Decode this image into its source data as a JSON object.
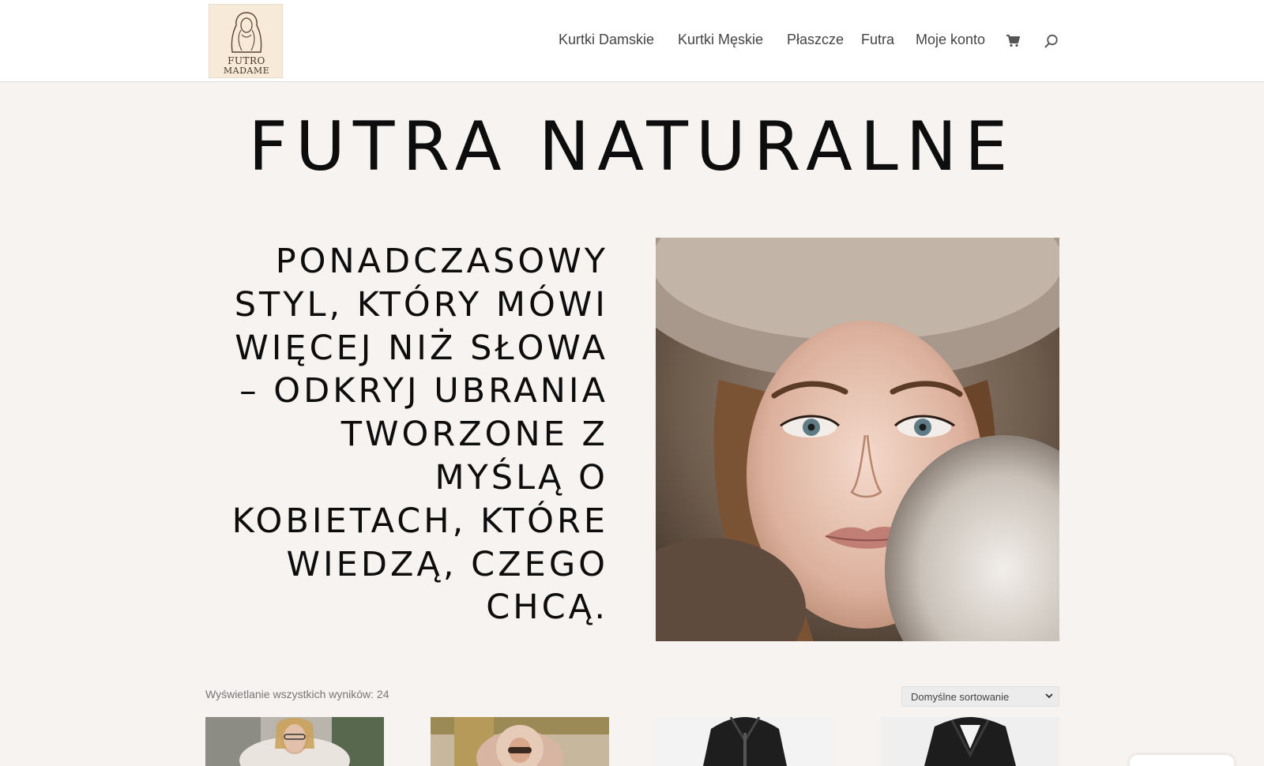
{
  "logo": {
    "line1": "FUTRO",
    "line2": "MADAME",
    "icon": "woman-in-fur-hood-illustration"
  },
  "nav": {
    "items": [
      "Kurtki Damskie",
      "Kurtki Męskie",
      "Płaszcze",
      "Futra",
      "Moje konto"
    ],
    "cart_icon": "shopping-cart-icon",
    "search_icon": "search-icon"
  },
  "page": {
    "title": "FUTRA NATURALNE",
    "hero_lines": [
      "PONADCZASOWY",
      "STYL, KTÓRY MÓWI",
      "WIĘCEJ NIŻ SŁOWA",
      "– ODKRYJ UBRANIA",
      "TWORZONE Z",
      "MYŚLĄ O",
      "KOBIETACH, KTÓRE",
      "WIEDZĄ, CZEGO",
      "CHCĄ."
    ]
  },
  "shop": {
    "results_count": "Wyświetlanie wszystkich wyników: 24",
    "sort_selected": "Domyślne sortowanie"
  },
  "colors": {
    "header_bg": "#ffffff",
    "page_bg": "#f6f3f1",
    "logo_bg": "#f7ead8",
    "nav_text": "#444444"
  }
}
